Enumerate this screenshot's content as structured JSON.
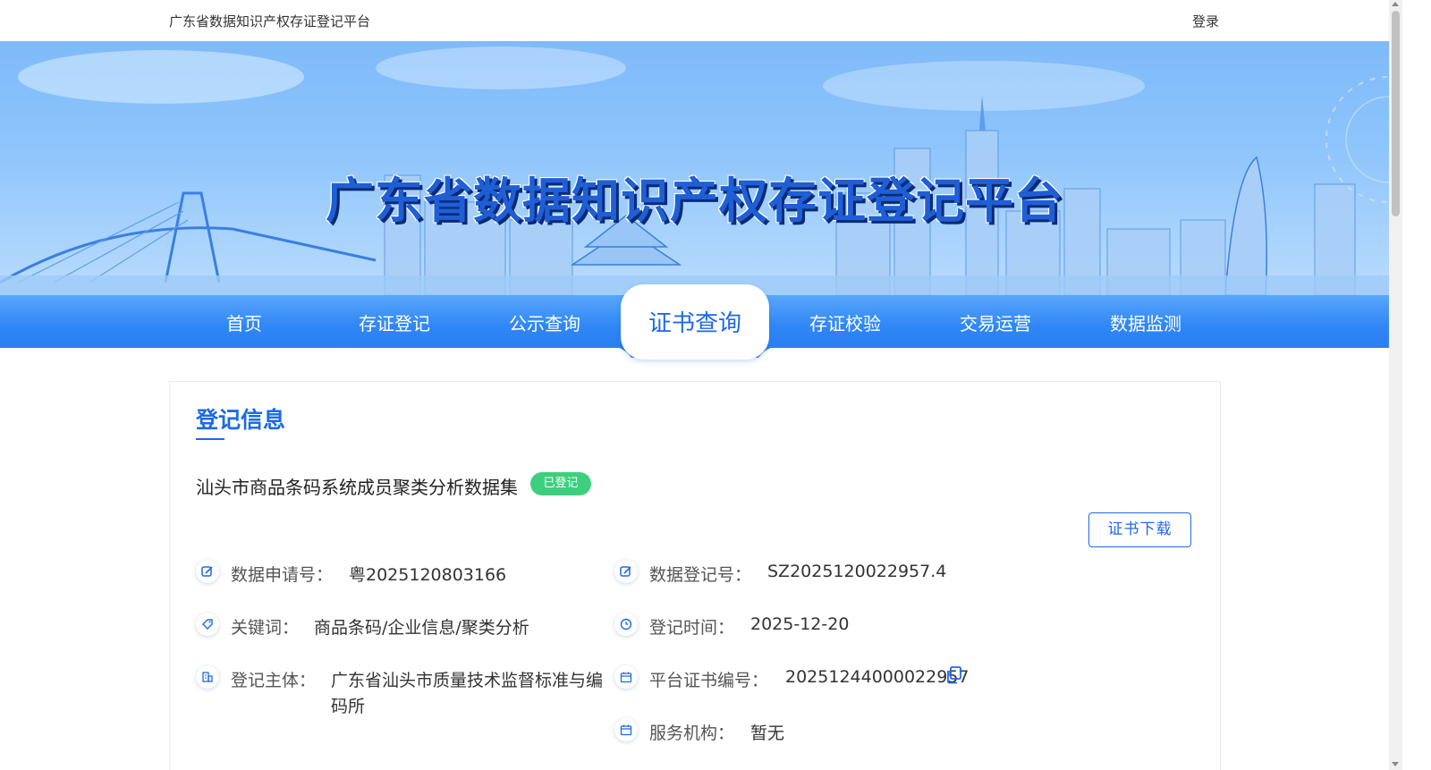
{
  "header": {
    "site_name": "广东省数据知识产权存证登记平台",
    "login_label": "登录"
  },
  "banner": {
    "title": "广东省数据知识产权存证登记平台"
  },
  "nav": {
    "items": [
      {
        "label": "首页",
        "active": false
      },
      {
        "label": "存证登记",
        "active": false
      },
      {
        "label": "公示查询",
        "active": false
      },
      {
        "label": "证书查询",
        "active": true
      },
      {
        "label": "存证校验",
        "active": false
      },
      {
        "label": "交易运营",
        "active": false
      },
      {
        "label": "数据监测",
        "active": false
      }
    ]
  },
  "section": {
    "title": "登记信息"
  },
  "record": {
    "name": "汕头市商品条码系统成员聚类分析数据集",
    "status": "已登记",
    "download_label": "证书下载",
    "fields": {
      "application_no": {
        "label": "数据申请号：",
        "value": "粤2025120803166",
        "icon": "edit-icon"
      },
      "registration_no": {
        "label": "数据登记号：",
        "value": "SZ2025120022957.4",
        "icon": "edit-icon"
      },
      "keywords": {
        "label": "关键词：",
        "value": "商品条码/企业信息/聚类分析",
        "icon": "tag-icon"
      },
      "registration_time": {
        "label": "登记时间：",
        "value": "2025-12-20",
        "icon": "clock-icon"
      },
      "registrant": {
        "label": "登记主体：",
        "value_line1": "广东省汕头市质量技术监督标准与编",
        "value_line2": "码所",
        "icon": "building-icon"
      },
      "certificate_no": {
        "label": "平台证书编号：",
        "value": "20251244000022957",
        "icon": "calendar-icon"
      },
      "service_agency": {
        "label": "服务机构：",
        "value": "暂无",
        "icon": "calendar-icon"
      }
    }
  },
  "colors": {
    "primary": "#1d6ae6",
    "nav_bg": "#2f86f5",
    "status_green": "#3ecf7e"
  }
}
